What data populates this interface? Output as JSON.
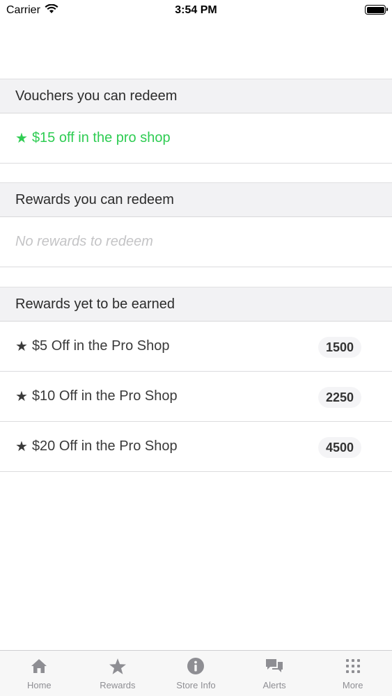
{
  "status_bar": {
    "carrier": "Carrier",
    "time": "3:54 PM"
  },
  "sections": {
    "vouchers": {
      "title": "Vouchers you can redeem",
      "items": [
        {
          "label": "$15 off in the pro shop"
        }
      ]
    },
    "rewards": {
      "title": "Rewards you can redeem",
      "empty_text": "No rewards to redeem"
    },
    "earned": {
      "title": "Rewards yet to be earned",
      "items": [
        {
          "label": "$5 Off in the Pro Shop",
          "points": "1500"
        },
        {
          "label": "$10 Off in the Pro Shop",
          "points": "2250"
        },
        {
          "label": "$20 Off in the Pro Shop",
          "points": "4500"
        }
      ]
    }
  },
  "star_glyph": "★",
  "tabs": [
    {
      "label": "Home",
      "icon": "home-icon"
    },
    {
      "label": "Rewards",
      "icon": "star-icon"
    },
    {
      "label": "Store Info",
      "icon": "info-icon"
    },
    {
      "label": "Alerts",
      "icon": "chat-bubbles-icon"
    },
    {
      "label": "More",
      "icon": "grid-dots-icon"
    }
  ],
  "colors": {
    "voucher_green": "#2ecc52",
    "tab_gray": "#8e8e93"
  }
}
